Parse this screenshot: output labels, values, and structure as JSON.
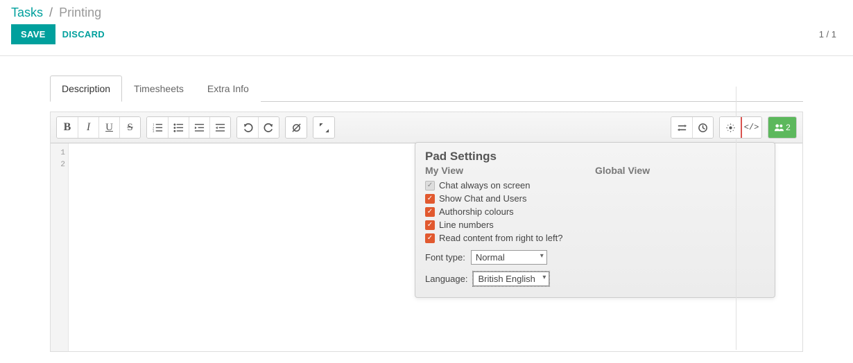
{
  "breadcrumb": {
    "root": "Tasks",
    "current": "Printing"
  },
  "actions": {
    "save": "SAVE",
    "discard": "DISCARD"
  },
  "pager": "1 / 1",
  "tabs": [
    {
      "label": "Description",
      "active": true
    },
    {
      "label": "Timesheets",
      "active": false
    },
    {
      "label": "Extra Info",
      "active": false
    }
  ],
  "gutter": {
    "l1": "1",
    "l2": "2"
  },
  "toolbar_right": {
    "users_count": "2"
  },
  "settings": {
    "title": "Pad Settings",
    "my_view": "My View",
    "global_view": "Global View",
    "options": {
      "chat_always": "Chat always on screen",
      "show_chat_users": "Show Chat and Users",
      "authorship": "Authorship colours",
      "line_numbers": "Line numbers",
      "rtl": "Read content from right to left?"
    },
    "font_label": "Font type:",
    "font_value": "Normal",
    "lang_label": "Language:",
    "lang_value": "British English"
  }
}
